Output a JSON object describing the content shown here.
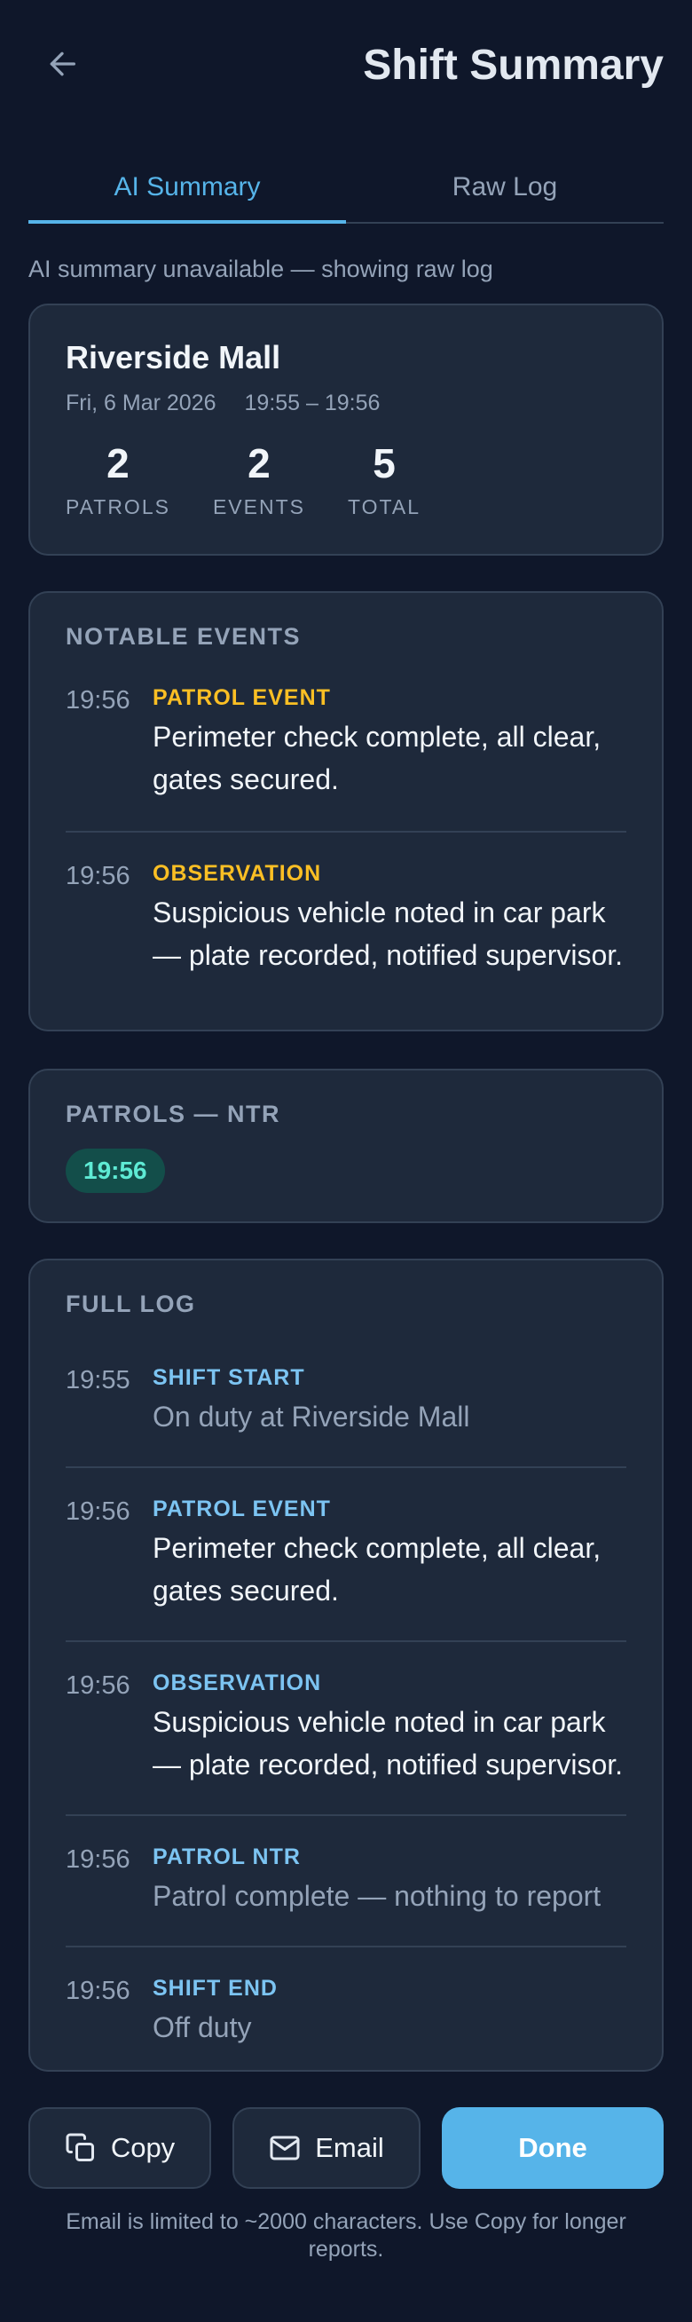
{
  "header": {
    "title": "Shift Summary",
    "back_icon": "arrow-left-icon"
  },
  "tabs": [
    {
      "label": "AI Summary",
      "active": true
    },
    {
      "label": "Raw Log",
      "active": false
    }
  ],
  "notice": "AI summary unavailable — showing raw log",
  "site": {
    "name": "Riverside Mall",
    "date": "Fri, 6 Mar 2026",
    "time_range": "19:55 – 19:56",
    "stats": [
      {
        "value": "2",
        "label": "PATROLS"
      },
      {
        "value": "2",
        "label": "EVENTS"
      },
      {
        "value": "5",
        "label": "TOTAL"
      }
    ]
  },
  "notable_events": {
    "title": "NOTABLE EVENTS",
    "items": [
      {
        "time": "19:56",
        "type": "PATROL EVENT",
        "text": "Perimeter check complete, all clear, gates secured."
      },
      {
        "time": "19:56",
        "type": "OBSERVATION",
        "text": "Suspicious vehicle noted in car park — plate recorded, notified supervisor."
      }
    ]
  },
  "patrols": {
    "title": "PATROLS — NTR",
    "chips": [
      "19:56"
    ]
  },
  "full_log": {
    "title": "FULL LOG",
    "items": [
      {
        "time": "19:55",
        "type": "SHIFT START",
        "text": "On duty at Riverside Mall",
        "muted": true
      },
      {
        "time": "19:56",
        "type": "PATROL EVENT",
        "text": "Perimeter check complete, all clear, gates secured.",
        "muted": false
      },
      {
        "time": "19:56",
        "type": "OBSERVATION",
        "text": "Suspicious vehicle noted in car park — plate recorded, notified supervisor.",
        "muted": false
      },
      {
        "time": "19:56",
        "type": "PATROL NTR",
        "text": "Patrol complete — nothing to report",
        "muted": true
      },
      {
        "time": "19:56",
        "type": "SHIFT END",
        "text": "Off duty",
        "muted": true
      }
    ]
  },
  "actions": {
    "copy_label": "Copy",
    "copy_icon": "copy-icon",
    "email_label": "Email",
    "email_icon": "mail-icon",
    "done_label": "Done"
  },
  "footnote": "Email is limited to ~2000 characters. Use Copy for longer reports.",
  "colors": {
    "background": "#0f172a",
    "card": "#1e293b",
    "accent": "#56b4e9",
    "amber": "#fbbf24",
    "teal": "#5eead4"
  }
}
